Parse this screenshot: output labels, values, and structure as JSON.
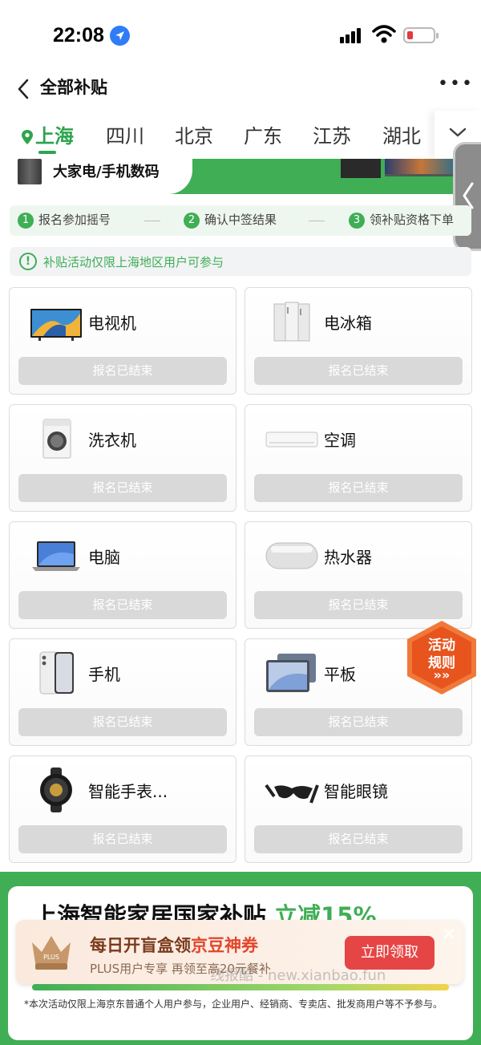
{
  "status_bar": {
    "time": "22:08",
    "location_icon": "location-arrow-icon",
    "battery_level": 0.15
  },
  "nav": {
    "back_icon": "chevron-left-icon",
    "title": "全部补贴",
    "more_icon": "more-horizontal-icon"
  },
  "region_tabs": {
    "items": [
      "上海",
      "四川",
      "北京",
      "广东",
      "江苏",
      "湖北"
    ],
    "active_index": 0,
    "active_icon": "location-pin-icon",
    "dropdown_icon": "chevron-down-icon"
  },
  "banner": {
    "label": "大家电/手机数码"
  },
  "steps": [
    {
      "num": "1",
      "label": "报名参加摇号"
    },
    {
      "num": "2",
      "label": "确认中签结果"
    },
    {
      "num": "3",
      "label": "领补贴资格下单"
    }
  ],
  "notice": {
    "icon": "exclamation-circle-icon",
    "text": "补贴活动仅限上海地区用户可参与"
  },
  "products": [
    {
      "name": "电视机",
      "icon": "tv-icon",
      "button": "报名已结束"
    },
    {
      "name": "电冰箱",
      "icon": "fridge-icon",
      "button": "报名已结束"
    },
    {
      "name": "洗衣机",
      "icon": "washing-machine-icon",
      "button": "报名已结束"
    },
    {
      "name": "空调",
      "icon": "air-conditioner-icon",
      "button": "报名已结束"
    },
    {
      "name": "电脑",
      "icon": "laptop-icon",
      "button": "报名已结束"
    },
    {
      "name": "热水器",
      "icon": "water-heater-icon",
      "button": "报名已结束"
    },
    {
      "name": "手机",
      "icon": "phone-icon",
      "button": "报名已结束"
    },
    {
      "name": "平板",
      "icon": "tablet-icon",
      "button": "报名已结束"
    },
    {
      "name": "智能手表...",
      "icon": "smartwatch-icon",
      "button": "报名已结束"
    },
    {
      "name": "智能眼镜",
      "icon": "smart-glasses-icon",
      "button": "报名已结束"
    }
  ],
  "rules_badge": {
    "line1": "活动",
    "line2": "规则",
    "arrow": "»»"
  },
  "bottom_section": {
    "headline_main": "上海智能家居国家补贴",
    "headline_highlight": "立减15%",
    "disclaimer": "*本次活动仅限上海京东普通个人用户参与，企业用户、经销商、专卖店、批发商用户等不予参与。"
  },
  "popup": {
    "crown_label": "PLUS",
    "title_main": "每日开盲盒领",
    "title_highlight": "京豆神券",
    "subtitle": "PLUS用户专享  再领至高20元餐补",
    "cta": "立即领取",
    "close_icon": "close-icon"
  },
  "watermark": "线报酷 - new.xianbao.fun",
  "colors": {
    "brand_green": "#3fae55",
    "cta_red": "#e64545",
    "badge_orange": "#e8541e"
  }
}
